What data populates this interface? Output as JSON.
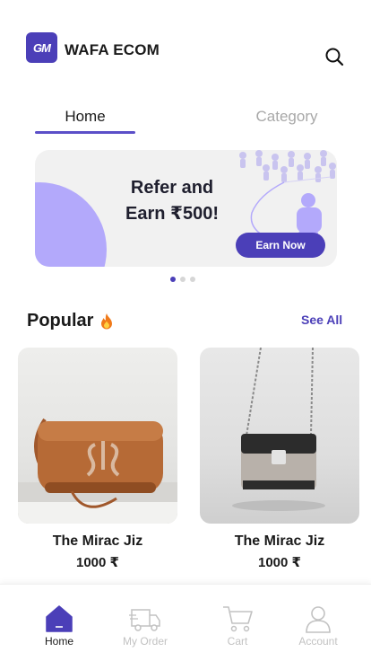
{
  "header": {
    "logo_text": "GM",
    "app_title": "WAFA ECOM",
    "search_icon": "search-icon"
  },
  "tabs": [
    {
      "label": "Home",
      "active": true
    },
    {
      "label": "Category",
      "active": false
    }
  ],
  "banner": {
    "line1": "Refer and",
    "line2": "Earn ₹500!",
    "button_label": "Earn Now"
  },
  "carousel": {
    "pages": 3,
    "active_index": 0
  },
  "popular": {
    "title": "Popular",
    "title_icon": "fire-icon",
    "see_all_label": "See All",
    "products": [
      {
        "name": "The Mirac Jiz",
        "price": "1000 ₹",
        "image": "brown-leather-camera-bag"
      },
      {
        "name": "The Mirac Jiz",
        "price": "1000 ₹",
        "image": "black-chain-strap-bag"
      }
    ]
  },
  "bottom_nav": [
    {
      "label": "Home",
      "icon": "home-icon",
      "active": true
    },
    {
      "label": "My Order",
      "icon": "truck-icon",
      "active": false
    },
    {
      "label": "Cart",
      "icon": "cart-icon",
      "active": false
    },
    {
      "label": "Account",
      "icon": "user-icon",
      "active": false
    }
  ],
  "colors": {
    "accent": "#4b3fb8",
    "tab_underline": "#5b4fc8",
    "banner_arc": "#b3a9fb",
    "inactive": "#c2c2c2"
  }
}
